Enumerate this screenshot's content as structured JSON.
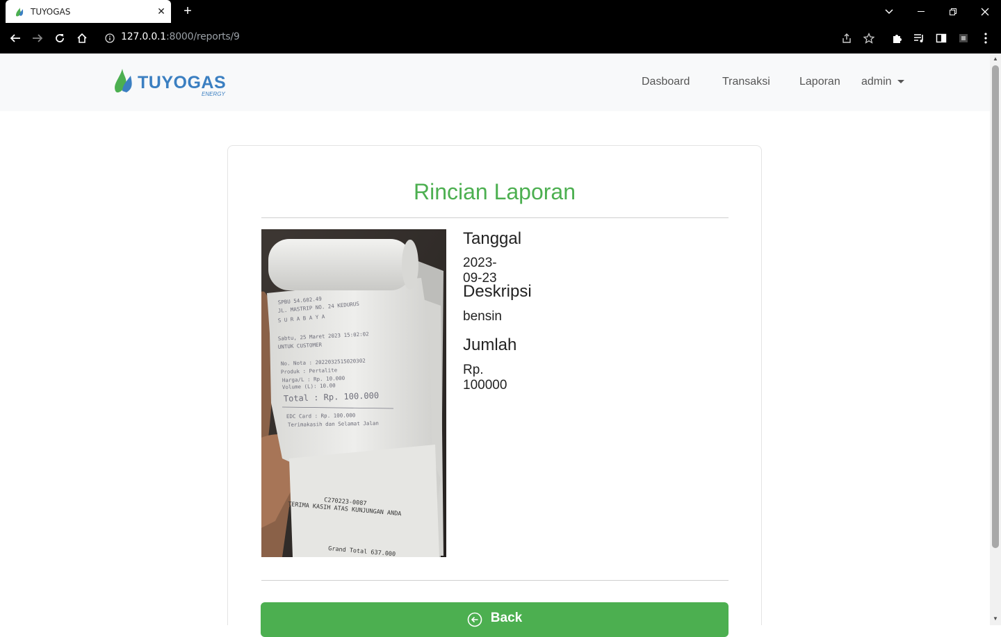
{
  "browser": {
    "tab_title": "TUYOGAS",
    "url_host": "127.0.0.1",
    "url_rest": ":8000/reports/9"
  },
  "navbar": {
    "brand_name": "TUYOGAS",
    "brand_sub": "ENERGY",
    "links": [
      "Dasboard",
      "Transaksi",
      "Laporan"
    ],
    "user": "admin"
  },
  "report": {
    "title": "Rincian Laporan",
    "date_label": "Tanggal",
    "date_value": "2023-09-23",
    "desc_label": "Deskripsi",
    "desc_value": "bensin",
    "amount_label": "Jumlah",
    "amount_value": "Rp. 100000",
    "back_label": "Back"
  },
  "receipt": {
    "lines": [
      "SPBU 54.602.49",
      "JL. MASTRIP NO. 24 KEDURUS",
      "S U R A B A Y A",
      "Sabtu, 25 Maret 2023 15:02:02",
      "UNTUK CUSTOMER",
      "No. Nota : 2022032515020302",
      "Produk : Pertalite",
      "Harga/L : Rp. 10.000",
      "Volume (L): 10.00",
      "Total : Rp. 100.000",
      "EDC Card : Rp. 100.000",
      "Terimakasih dan Selamat Jalan",
      "C270223-0087",
      "TERIMA KASIH ATAS KUNJUNGAN ANDA",
      "Grand Total 637.000"
    ]
  },
  "colors": {
    "accent": "#4caf50",
    "brand": "#3b7fc1"
  }
}
